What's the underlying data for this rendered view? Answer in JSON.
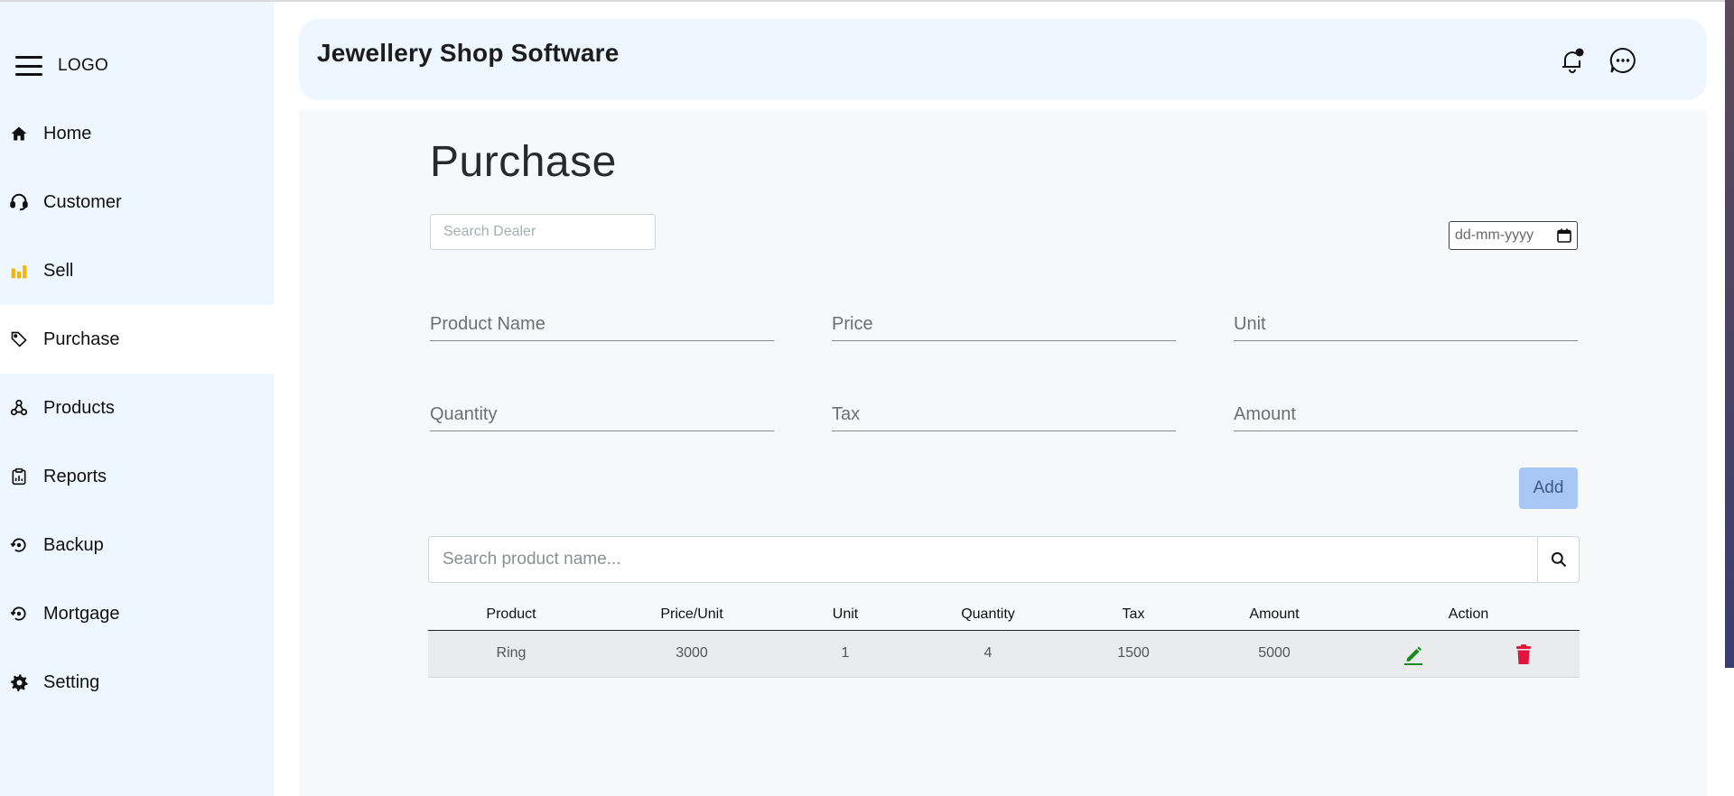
{
  "sidebar": {
    "logo": "LOGO",
    "items": [
      {
        "label": "Home",
        "icon": "home-icon"
      },
      {
        "label": "Customer",
        "icon": "headset-icon"
      },
      {
        "label": "Sell",
        "icon": "bar-chart-icon"
      },
      {
        "label": "Purchase",
        "icon": "tag-icon",
        "active": true
      },
      {
        "label": "Products",
        "icon": "webhook-icon"
      },
      {
        "label": "Reports",
        "icon": "clipboard-icon"
      },
      {
        "label": "Backup",
        "icon": "history-icon"
      },
      {
        "label": "Mortgage",
        "icon": "history-icon"
      },
      {
        "label": "Setting",
        "icon": "gear-icon"
      }
    ]
  },
  "header": {
    "title": "Jewellery Shop Software",
    "icons": [
      "notification-bell-icon",
      "chat-icon"
    ]
  },
  "main": {
    "page_title": "Purchase",
    "dealer_search_placeholder": "Search Dealer",
    "date_placeholder": "dd-mm-yyyy",
    "fields": {
      "product_name": "Product Name",
      "price": "Price",
      "unit": "Unit",
      "quantity": "Quantity",
      "tax": "Tax",
      "amount": "Amount"
    },
    "add_label": "Add",
    "product_search_placeholder": "Search product name...",
    "table": {
      "headers": {
        "product": "Product",
        "price_unit": "Price/Unit",
        "unit": "Unit",
        "quantity": "Quantity",
        "tax": "Tax",
        "amount": "Amount",
        "action": "Action"
      },
      "rows": [
        {
          "product": "Ring",
          "price_unit": "3000",
          "unit": "1",
          "quantity": "4",
          "tax": "1500",
          "amount": "5000"
        }
      ]
    }
  },
  "colors": {
    "sidebar_bg": "#eef6ff",
    "accent_button": "#a9c7f5",
    "edit_icon": "#1a8a1a",
    "delete_icon": "#e0143c"
  }
}
